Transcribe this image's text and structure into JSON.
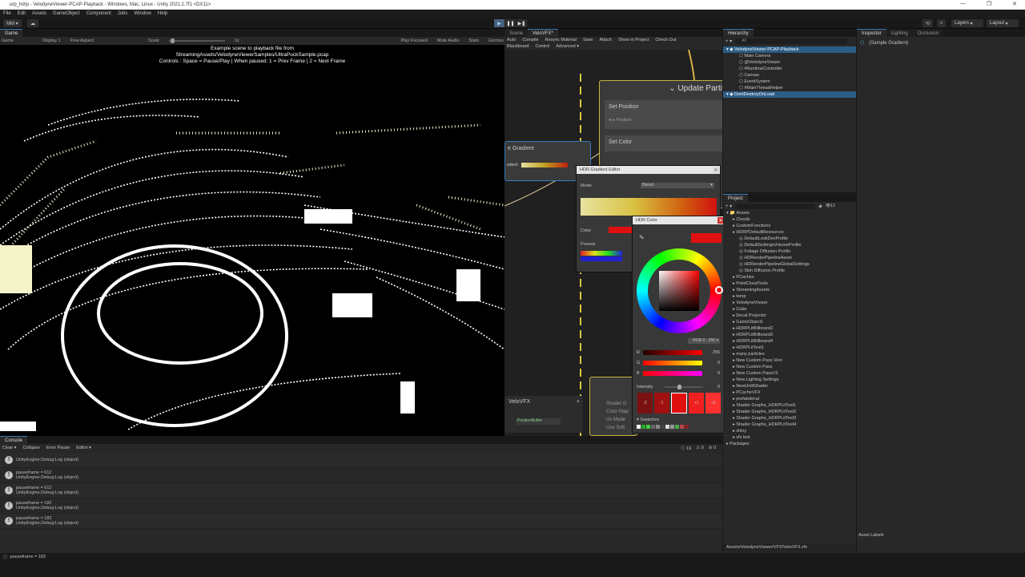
{
  "window": {
    "title": "urp_hdrp - VelodyneViewer-PCAP-Playback - Windows, Mac, Linux - Unity 2021.2.7f1 <DX11>",
    "minimize": "—",
    "restore": "❐",
    "close": "✕"
  },
  "menu": [
    "File",
    "Edit",
    "Assets",
    "GameObject",
    "Component",
    "Jobs",
    "Window",
    "Help"
  ],
  "toolbar": {
    "account": "MM ▾",
    "layers": "Layers",
    "layout": "Layout"
  },
  "game": {
    "tab": "Game",
    "display_mode": "Game",
    "display": "Display 1",
    "aspect": "Free Aspect",
    "scale_label": "Scale",
    "scale_value": "1x",
    "play_focused": "Play Focused",
    "mute_audio": "Mute Audio",
    "stats": "Stats",
    "gizmos": "Gizmos",
    "caption": [
      "Example scene to playback file from",
      "StreamingAssets/VelodyneViewerSamples/UltraPuckSample.pcap",
      "Controls : Space = Pause/Play | When paused: 1 = Prev Frame | 2 = Next Frame"
    ]
  },
  "vfx": {
    "tabs": [
      "Scene",
      "VeloVFX*"
    ],
    "buttons": [
      "Auto",
      "Compile",
      "Resync Material",
      "Save",
      "Attach",
      "Show in Project",
      "Check Out"
    ],
    "buttons2": [
      "Blackboard",
      "Control",
      "Advanced ▾"
    ],
    "update_title": "Update Partic",
    "blocks": [
      "Set Position",
      "Set Color"
    ],
    "pos_field": "Position",
    "gradient_node": "e Gradient",
    "gradient_label": "adient",
    "blackboard_title": "VeloVFX",
    "blackboard_item": "PositionBuffer",
    "shader_lines": [
      "Shader G",
      "Color Map",
      "Uv Mode",
      "Use Soft"
    ]
  },
  "hdr_gradient": {
    "title": "HDR Gradient Editor",
    "mode_label": "Mode",
    "mode_value": "Blend",
    "color_label": "Color",
    "presets_label": "Presets"
  },
  "hdr_color": {
    "title": "HDR Color",
    "mode": "RGB 0 - 255 ▾",
    "channels": [
      {
        "label": "R",
        "value": "255"
      },
      {
        "label": "G",
        "value": "0"
      },
      {
        "label": "B",
        "value": "0"
      }
    ],
    "intensity_label": "Intensity",
    "intensity_value": "0",
    "swatch_labels": [
      "-2",
      "-1",
      "",
      "+1",
      "+2"
    ],
    "swatches_label": "▾ Swatches",
    "accent": "#e01010"
  },
  "hierarchy": {
    "tab": "Hierarchy",
    "search": "All",
    "items": [
      {
        "label": "VelodyneViewer-PCAP-Playback",
        "indent": 0,
        "selected": true
      },
      {
        "label": "Main Camera",
        "indent": 2
      },
      {
        "label": "@VelodyneViewer",
        "indent": 2
      },
      {
        "label": "#RuntimeController",
        "indent": 2
      },
      {
        "label": "Canvas",
        "indent": 2
      },
      {
        "label": "EventSystem",
        "indent": 2
      },
      {
        "label": "#MainThreadHelper",
        "indent": 2
      },
      {
        "label": "DontDestroyOnLoad",
        "indent": 0,
        "selected": true
      }
    ]
  },
  "project": {
    "tab": "Project",
    "count": "12",
    "root": "Assets",
    "items": [
      {
        "label": "Clouds",
        "indent": 1
      },
      {
        "label": "CustomFunctions",
        "indent": 1
      },
      {
        "label": "HDRPDefaultResources",
        "indent": 1
      },
      {
        "label": "DefaultLookDevProfile",
        "indent": 2
      },
      {
        "label": "DefaultSettingsVolumeProfile",
        "indent": 2
      },
      {
        "label": "Foliage Diffusion Profile",
        "indent": 2
      },
      {
        "label": "HDRenderPipelineAsset",
        "indent": 2
      },
      {
        "label": "HDRenderPipelineGlobalSettings",
        "indent": 2
      },
      {
        "label": "Skin Diffusion Profile",
        "indent": 2
      },
      {
        "label": "PCaches",
        "indent": 1
      },
      {
        "label": "PointCloudTools",
        "indent": 1
      },
      {
        "label": "StreamingAssets",
        "indent": 1
      },
      {
        "label": "temp",
        "indent": 1
      },
      {
        "label": "VelodyneViewer",
        "indent": 1
      },
      {
        "label": "Cube",
        "indent": 1
      },
      {
        "label": "Decal Projector",
        "indent": 1
      },
      {
        "label": "GameObject1",
        "indent": 1
      },
      {
        "label": "HDRPLitBillboard2",
        "indent": 1
      },
      {
        "label": "HDRPLitBillboard3",
        "indent": 1
      },
      {
        "label": "HDRPLitBillboard4",
        "indent": 1
      },
      {
        "label": "HDRPLitTest1",
        "indent": 1
      },
      {
        "label": "many particles",
        "indent": 1
      },
      {
        "label": "New Custom Pass Vein",
        "indent": 1
      },
      {
        "label": "New Custom Pass",
        "indent": 1
      },
      {
        "label": "New Custom PassV3",
        "indent": 1
      },
      {
        "label": "New Lighting Settings",
        "indent": 1
      },
      {
        "label": "NewUnlitShader",
        "indent": 1
      },
      {
        "label": "PCacheVFX",
        "indent": 1
      },
      {
        "label": "prefabdecal",
        "indent": 1
      },
      {
        "label": "Shader Graphs_HDRPLitTest1",
        "indent": 1
      },
      {
        "label": "Shader Graphs_HDRPLitTest2",
        "indent": 1
      },
      {
        "label": "Shader Graphs_HDRPLitTest3",
        "indent": 1
      },
      {
        "label": "Shader Graphs_HDRPLitTest4",
        "indent": 1
      },
      {
        "label": "shiny",
        "indent": 1
      },
      {
        "label": "vfx test",
        "indent": 1
      },
      {
        "label": "Packages",
        "indent": 0
      }
    ],
    "path": "Assets/VelodyneViewer/VFX/VeloVFX.vfx"
  },
  "inspector": {
    "tabs": [
      "Inspector",
      "Lighting",
      "Occlusion"
    ],
    "selection": "(Sample Gradient)",
    "asset_labels": "Asset Labels"
  },
  "console": {
    "tab": "Console",
    "buttons": [
      "Clear ▾",
      "Collapse",
      "Error Pause",
      "Editor ▾"
    ],
    "counts": [
      "19",
      "0",
      "0"
    ],
    "logs": [
      {
        "msg": "",
        "sub": "UnityEngine.Debug:Log (object)"
      },
      {
        "msg": "pauseframe = 612",
        "sub": "UnityEngine.Debug:Log (object)"
      },
      {
        "msg": "pauseframe = 612",
        "sub": "UnityEngine.Debug:Log (object)"
      },
      {
        "msg": "pauseframe = 182",
        "sub": "UnityEngine.Debug:Log (object)"
      },
      {
        "msg": "pauseframe = 182",
        "sub": "UnityEngine.Debug:Log (object)"
      }
    ]
  },
  "status": "pauseframe = 182"
}
